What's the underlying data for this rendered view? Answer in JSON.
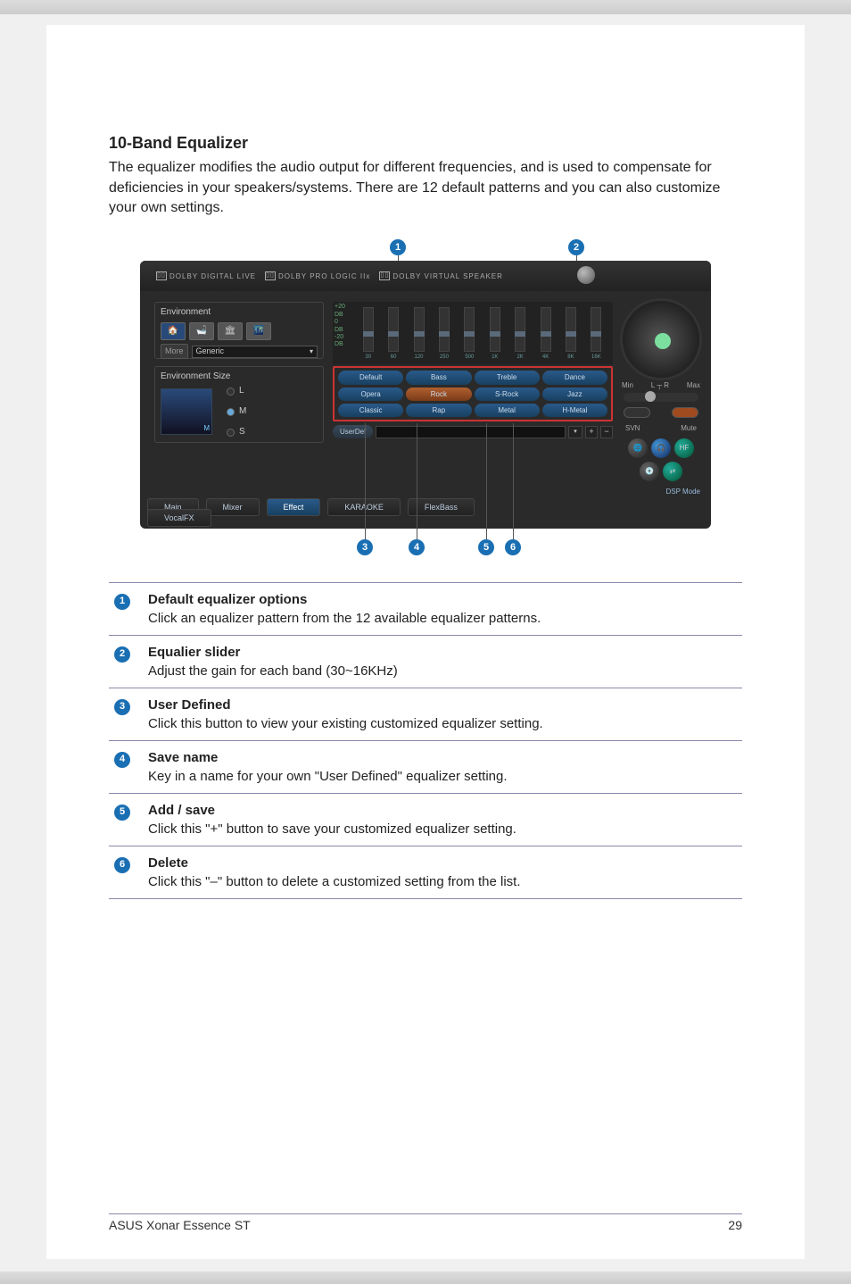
{
  "section": {
    "title": "10-Band Equalizer",
    "body": "The equalizer modifies the audio output for different frequencies, and is used to compensate for deficiencies in your speakers/systems. There are 12 default patterns and you can also customize your own settings."
  },
  "panel": {
    "brands": [
      "DOLBY DIGITAL LIVE",
      "DOLBY PRO LOGIC IIx",
      "DOLBY VIRTUAL SPEAKER"
    ],
    "environment": {
      "label": "Environment",
      "more": "More",
      "selected": "Generic"
    },
    "environmentSize": {
      "label": "Environment Size",
      "options": [
        "L",
        "M",
        "S"
      ],
      "selected": "M"
    },
    "equalizer": {
      "db_labels": [
        "+20",
        "DB",
        "0",
        "DB",
        "-20",
        "DB"
      ],
      "freqs": [
        "30",
        "60",
        "120",
        "250",
        "500",
        "1K",
        "2K",
        "4K",
        "8K",
        "16K"
      ],
      "presets": [
        "Default",
        "Bass",
        "Treble",
        "Dance",
        "Opera",
        "Rock",
        "S-Rock",
        "Jazz",
        "Classic",
        "Rap",
        "Metal",
        "H-Metal"
      ],
      "preset_selected": "Rock",
      "userdef": "UserDef"
    },
    "tabs_row1": [
      "Main",
      "Mixer",
      "Effect",
      "KARAOKE",
      "FlexBass"
    ],
    "tabs_row2": [
      "VocalFX"
    ],
    "tab_selected": "Effect",
    "volume": {
      "min": "Min",
      "max": "Max",
      "l": "L",
      "r": "R"
    },
    "svn": "SVN",
    "mute": "Mute",
    "hf": "HF",
    "dsp": "DSP Mode"
  },
  "callouts": [
    "1",
    "2",
    "3",
    "4",
    "5",
    "6"
  ],
  "table": [
    {
      "n": "1",
      "title": "Default equalizer options",
      "body": "Click an equalizer pattern from the 12 available equalizer patterns."
    },
    {
      "n": "2",
      "title": "Equalier slider",
      "body": "Adjust the gain for each band (30~16KHz)"
    },
    {
      "n": "3",
      "title": "User Defined",
      "body": "Click this button to view your existing customized equalizer setting."
    },
    {
      "n": "4",
      "title": "Save name",
      "body": "Key in a name for your own \"User Defined\" equalizer setting."
    },
    {
      "n": "5",
      "title": "Add / save",
      "body": "Click this \"+\" button to save your customized equalizer setting."
    },
    {
      "n": "6",
      "title": "Delete",
      "body": "Click this \"–\" button to delete a customized setting from the list."
    }
  ],
  "footer": {
    "left": "ASUS Xonar Essence ST",
    "right": "29"
  }
}
